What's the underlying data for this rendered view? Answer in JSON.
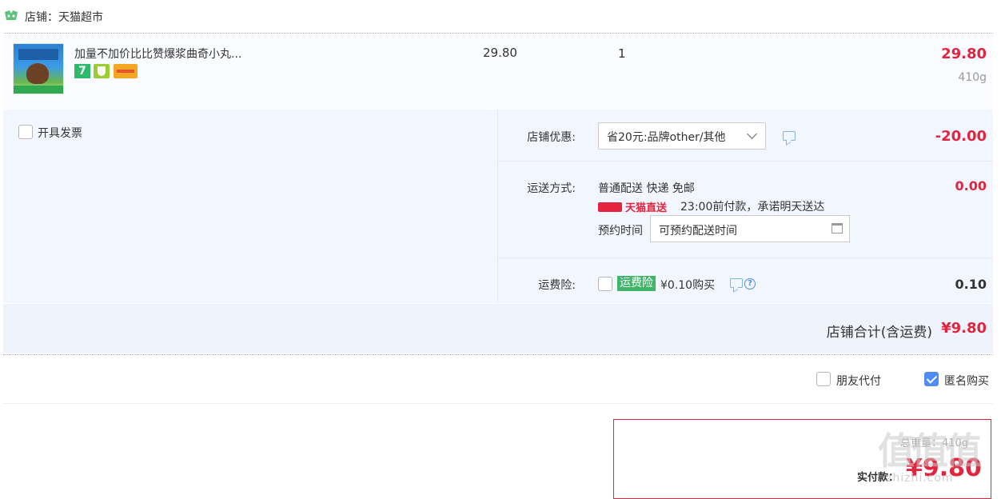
{
  "shop": {
    "label": "店铺：天猫超市"
  },
  "item": {
    "title": "加量不加价比比赞爆浆曲奇小丸...",
    "tag_7": "7",
    "unit_price": "29.80",
    "quantity": "1",
    "total": "29.80",
    "weight": "410g"
  },
  "invoice": {
    "label": "开具发票"
  },
  "store_discount": {
    "label": "店铺优惠:",
    "selected": "省20元:品牌other/其他",
    "amount": "-20.00"
  },
  "shipping": {
    "label": "运送方式:",
    "method": "普通配送 快递 免邮",
    "badge": "天猫直送",
    "promise": "23:00前付款，承诺明天送达",
    "appoint_label": "预约时间",
    "appoint_placeholder": "可预约配送时间",
    "amount": "0.00"
  },
  "insurance": {
    "label": "运费险:",
    "tag": "运费险",
    "price": "¥0.10购买",
    "help": "?",
    "amount": "0.10"
  },
  "subtotal": {
    "label": "店铺合计(含运费)",
    "value": "¥9.80"
  },
  "options": {
    "friend_pay": "朋友代付",
    "anonymous": "匿名购买"
  },
  "payment": {
    "weight": "总重量：410g",
    "label": "实付款：",
    "amount": "¥9.80"
  },
  "watermark": {
    "text": "值值值",
    "url": "zhizhi.com"
  },
  "colors": {
    "accent_red": "#e4243e",
    "link_blue": "#4f8cf7",
    "panel_bg": "#f2f7ff"
  }
}
